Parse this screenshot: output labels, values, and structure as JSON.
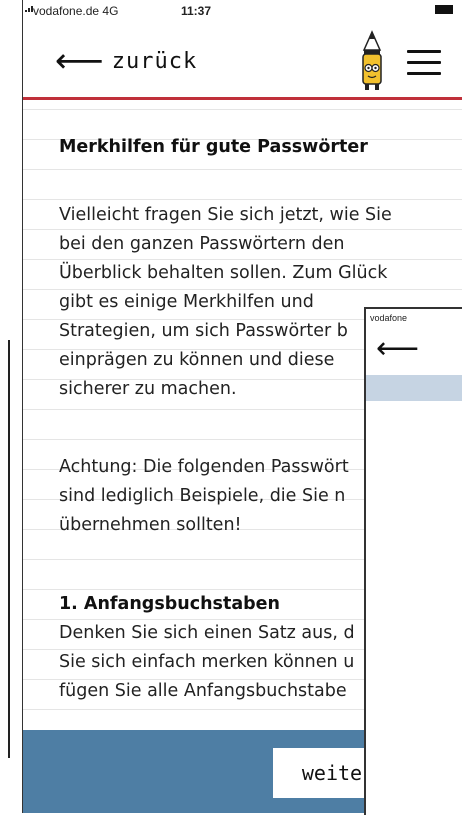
{
  "status_bar": {
    "carrier": "vodafone.de  4G",
    "time": "11:37"
  },
  "header": {
    "back_label": "zurück",
    "logo_icon": "pencil-mascot-icon",
    "menu_icon": "hamburger-menu-icon"
  },
  "content": {
    "heading": "Merkhilfen für gute Passwörter",
    "intro_lines": [
      "Vielleicht fragen Sie sich jetzt, wie Sie",
      "bei den ganzen Passwörtern den",
      "Überblick behalten sollen. Zum Glück",
      "gibt es einige Merkhilfen und",
      "Strategien, um sich Passwörter b",
      "einprägen zu können und diese",
      "sicherer zu machen."
    ],
    "warning_lines": [
      "Achtung: Die folgenden Passwört",
      "sind lediglich Beispiele, die Sie n",
      "übernehmen sollten!"
    ],
    "section_heading": "1. Anfangsbuchstaben",
    "section_lines": [
      "Denken Sie sich einen Satz aus, d",
      "Sie sich einfach merken können u",
      "fügen Sie alle Anfangsbuchstabe"
    ]
  },
  "footer": {
    "next_label": "weiter"
  },
  "overlay": {
    "carrier": "vodafone"
  },
  "colors": {
    "accent_red": "#c0303a",
    "footer_blue": "#4e7ea4",
    "overlay_band": "#c6d4e3"
  }
}
